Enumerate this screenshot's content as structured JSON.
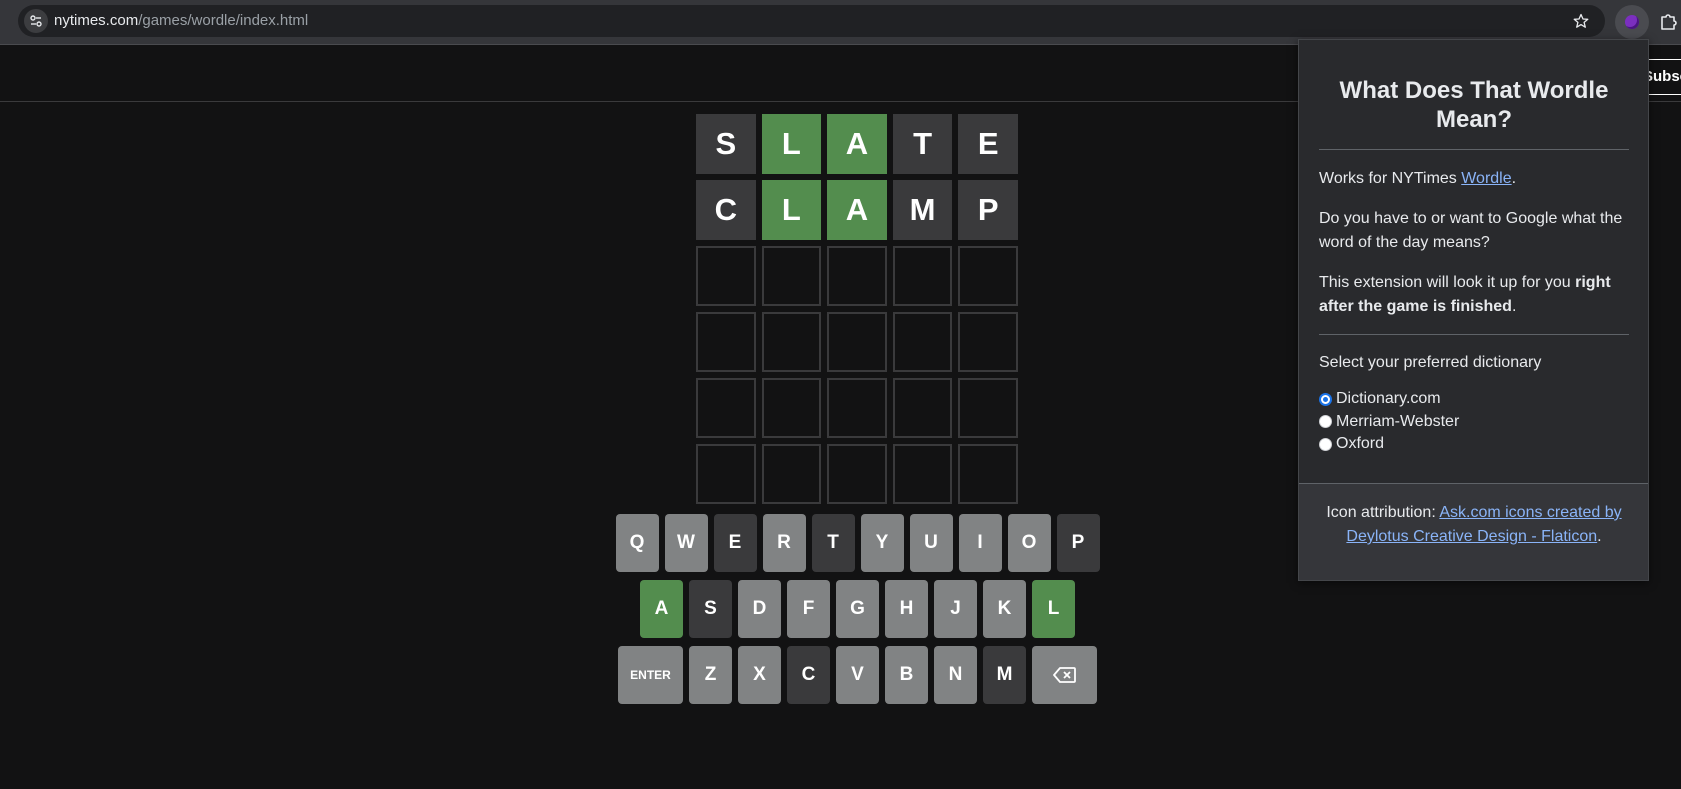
{
  "browser": {
    "url_domain": "nytimes.com",
    "url_path": "/games/wordle/index.html"
  },
  "header": {
    "subscribe_label": "Subscribe"
  },
  "board": {
    "rows": [
      [
        {
          "letter": "S",
          "state": "absent"
        },
        {
          "letter": "L",
          "state": "correct"
        },
        {
          "letter": "A",
          "state": "correct"
        },
        {
          "letter": "T",
          "state": "absent"
        },
        {
          "letter": "E",
          "state": "absent"
        }
      ],
      [
        {
          "letter": "C",
          "state": "absent"
        },
        {
          "letter": "L",
          "state": "correct"
        },
        {
          "letter": "A",
          "state": "correct"
        },
        {
          "letter": "M",
          "state": "absent"
        },
        {
          "letter": "P",
          "state": "absent"
        }
      ],
      [
        {
          "letter": "",
          "state": "empty"
        },
        {
          "letter": "",
          "state": "empty"
        },
        {
          "letter": "",
          "state": "empty"
        },
        {
          "letter": "",
          "state": "empty"
        },
        {
          "letter": "",
          "state": "empty"
        }
      ],
      [
        {
          "letter": "",
          "state": "empty"
        },
        {
          "letter": "",
          "state": "empty"
        },
        {
          "letter": "",
          "state": "empty"
        },
        {
          "letter": "",
          "state": "empty"
        },
        {
          "letter": "",
          "state": "empty"
        }
      ],
      [
        {
          "letter": "",
          "state": "empty"
        },
        {
          "letter": "",
          "state": "empty"
        },
        {
          "letter": "",
          "state": "empty"
        },
        {
          "letter": "",
          "state": "empty"
        },
        {
          "letter": "",
          "state": "empty"
        }
      ],
      [
        {
          "letter": "",
          "state": "empty"
        },
        {
          "letter": "",
          "state": "empty"
        },
        {
          "letter": "",
          "state": "empty"
        },
        {
          "letter": "",
          "state": "empty"
        },
        {
          "letter": "",
          "state": "empty"
        }
      ]
    ]
  },
  "keyboard": {
    "rows": [
      [
        {
          "label": "Q",
          "state": "unused"
        },
        {
          "label": "W",
          "state": "unused"
        },
        {
          "label": "E",
          "state": "absent"
        },
        {
          "label": "R",
          "state": "unused"
        },
        {
          "label": "T",
          "state": "absent"
        },
        {
          "label": "Y",
          "state": "unused"
        },
        {
          "label": "U",
          "state": "unused"
        },
        {
          "label": "I",
          "state": "unused"
        },
        {
          "label": "O",
          "state": "unused"
        },
        {
          "label": "P",
          "state": "absent"
        }
      ],
      [
        {
          "label": "A",
          "state": "correct"
        },
        {
          "label": "S",
          "state": "absent"
        },
        {
          "label": "D",
          "state": "unused"
        },
        {
          "label": "F",
          "state": "unused"
        },
        {
          "label": "G",
          "state": "unused"
        },
        {
          "label": "H",
          "state": "unused"
        },
        {
          "label": "J",
          "state": "unused"
        },
        {
          "label": "K",
          "state": "unused"
        },
        {
          "label": "L",
          "state": "correct"
        }
      ],
      [
        {
          "label": "ENTER",
          "state": "unused",
          "wide": true
        },
        {
          "label": "Z",
          "state": "unused"
        },
        {
          "label": "X",
          "state": "unused"
        },
        {
          "label": "C",
          "state": "absent"
        },
        {
          "label": "V",
          "state": "unused"
        },
        {
          "label": "B",
          "state": "unused"
        },
        {
          "label": "N",
          "state": "unused"
        },
        {
          "label": "M",
          "state": "absent"
        },
        {
          "label": "",
          "state": "unused",
          "wide": true,
          "icon": "backspace-icon"
        }
      ]
    ]
  },
  "popup": {
    "title": "What Does That Wordle Mean?",
    "works_prefix": "Works for NYTimes ",
    "works_link": "Wordle",
    "works_suffix": ".",
    "question": "Do you have to or want to Google what the word of the day means?",
    "lookup_prefix": "This extension will look it up for you ",
    "lookup_bold": "right after the game is finished",
    "lookup_suffix": ".",
    "select_label": "Select your preferred dictionary",
    "dictionaries": [
      {
        "label": "Dictionary.com",
        "checked": true
      },
      {
        "label": "Merriam-Webster",
        "checked": false
      },
      {
        "label": "Oxford",
        "checked": false
      }
    ],
    "attribution_prefix": "Icon attribution: ",
    "attribution_link": "Ask.com icons created by Deylotus Creative Design - Flaticon",
    "attribution_suffix": "."
  },
  "colors": {
    "correct": "#538d4e",
    "absent": "#3a3a3c",
    "unused_key": "#818384",
    "background": "#121213",
    "link": "#8ab4f8"
  }
}
